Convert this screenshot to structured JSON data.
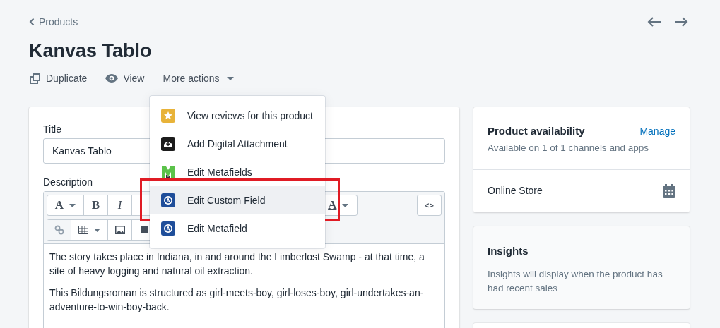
{
  "breadcrumb": "Products",
  "title": "Kanvas Tablo",
  "actions": [
    {
      "kind": "duplicate",
      "label": "Duplicate"
    },
    {
      "kind": "view",
      "label": "View"
    },
    {
      "kind": "more",
      "label": "More actions"
    }
  ],
  "menu": [
    {
      "kind": "reviews",
      "label": "View reviews for this product",
      "selected": false,
      "highlighted": false
    },
    {
      "kind": "attachment",
      "label": "Add Digital Attachment",
      "selected": false,
      "highlighted": false
    },
    {
      "kind": "metafields",
      "label": "Edit Metafields",
      "selected": false,
      "highlighted": false
    },
    {
      "kind": "customfield",
      "label": "Edit Custom Field",
      "selected": true,
      "highlighted": true
    },
    {
      "kind": "customfield",
      "label": "Edit Metafield",
      "selected": false,
      "highlighted": false
    }
  ],
  "form": {
    "title_label": "Title",
    "title_value": "Kanvas Tablo",
    "description_label": "Description",
    "toolbar_row_1": [
      {
        "kind": "font",
        "label": "A",
        "caret": true
      },
      {
        "kind": "bold",
        "label": "B",
        "caret": false
      },
      {
        "kind": "italic",
        "label": "I",
        "caret": false
      }
    ],
    "toolbar_right": [
      {
        "kind": "textcolor",
        "label": "A",
        "caret": true
      }
    ],
    "code_button": "<>",
    "toolbar_row_2": [
      {
        "kind": "link",
        "caret": false
      },
      {
        "kind": "table",
        "caret": true
      },
      {
        "kind": "image",
        "caret": false
      },
      {
        "kind": "block",
        "caret": false
      }
    ],
    "paragraphs": [
      "The story takes place in Indiana, in and around the Limberlost Swamp - at that time, a site of heavy logging and natural oil extraction.",
      "This Bildungsroman is structured as girl-meets-boy, girl-loses-boy, girl-undertakes-an-adventure-to-win-boy-back."
    ]
  },
  "availability": {
    "title": "Product availability",
    "link": "Manage",
    "subtitle": "Available on 1 of 1 channels and apps",
    "channel": "Online Store"
  },
  "insights": {
    "title": "Insights",
    "text": "Insights will display when the product has had recent sales"
  }
}
